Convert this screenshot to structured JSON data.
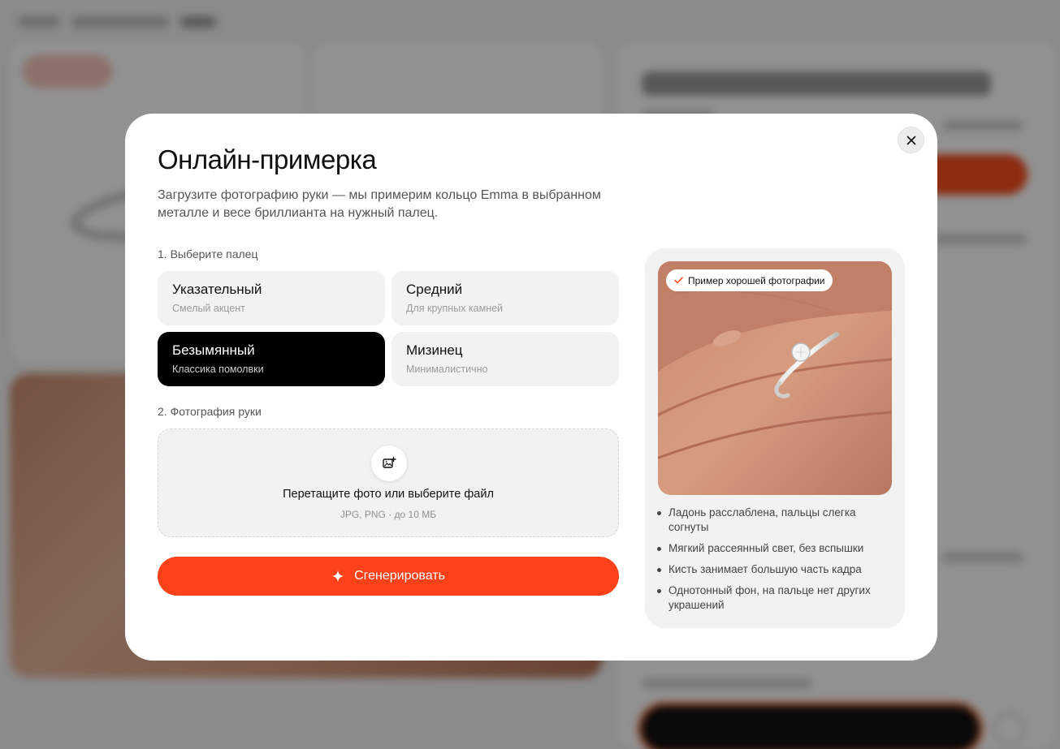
{
  "modal": {
    "title": "Онлайн-примерка",
    "subtitle": "Загрузите фотографию руки — мы примерим кольцо Emma в выбранном металле и весе бриллианта на нужный палец.",
    "close_icon": "close-icon"
  },
  "finger_section": {
    "label": "1. Выберите палец",
    "selected": "Безымянный",
    "options": [
      {
        "name": "Указательный",
        "desc": "Смелый акцент"
      },
      {
        "name": "Средний",
        "desc": "Для крупных камней"
      },
      {
        "name": "Безымянный",
        "desc": "Классика помолвки"
      },
      {
        "name": "Мизинец",
        "desc": "Минималистично"
      }
    ]
  },
  "photo_section": {
    "label": "2. Фотография руки",
    "upload_icon": "image-upload-icon",
    "dropzone_title": "Перетащите фото или выберите файл",
    "dropzone_hint": "JPG, PNG · до 10 МБ"
  },
  "generate_button": {
    "label": "Сгенерировать",
    "icon": "sparkle-icon"
  },
  "example": {
    "badge": "Пример хорошей фотографии",
    "badge_icon": "check-icon",
    "tips": [
      "Ладонь расслаблена, пальцы слегка согнуты",
      "Мягкий рассеянный свет, без вспышки",
      "Кисть занимает большую часть кадра",
      "Однотонный фон, на пальце нет других украшений"
    ]
  },
  "colors": {
    "accent": "#fd4119",
    "selected_card": "#000000",
    "card_bg": "#f2f2f2",
    "overlay": "rgba(0,0,0,0.42)"
  }
}
